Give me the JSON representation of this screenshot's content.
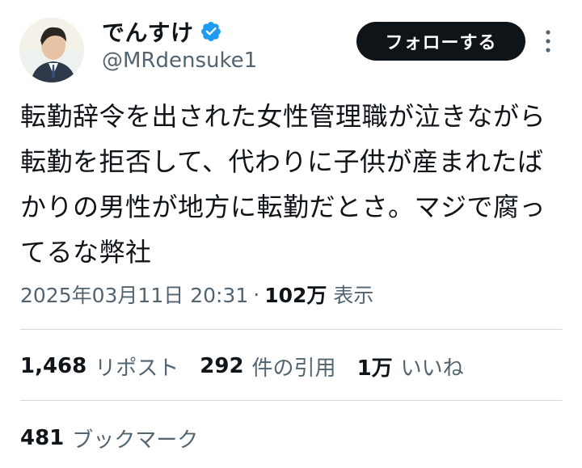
{
  "user": {
    "display_name": "でんすけ",
    "handle": "@MRdensuke1",
    "verified_icon": "verified-badge-icon",
    "verified_color": "#1d9bf0"
  },
  "follow_button": {
    "label": "フォローする"
  },
  "more_icon": "more-vertical-icon",
  "tweet": {
    "text": "転勤辞令を出された女性管理職が泣きながら転勤を拒否して、代わりに子供が産まれたばかりの男性が地方に転勤だとさ。マジで腐ってるな弊社"
  },
  "meta": {
    "timestamp": "2025年03月11日 20:31",
    "separator": "·",
    "views_count": "102万",
    "views_label": "表示"
  },
  "stats": {
    "reposts_count": "1,468",
    "reposts_label": "リポスト",
    "quotes_count": "292",
    "quotes_label": "件の引用",
    "likes_count": "1万",
    "likes_label": "いいね",
    "bookmarks_count": "481",
    "bookmarks_label": "ブックマーク"
  },
  "colors": {
    "text_primary": "#0f1419",
    "text_secondary": "#536471",
    "divider": "#cfd9de",
    "button_bg": "#0f1419",
    "button_text": "#ffffff"
  }
}
